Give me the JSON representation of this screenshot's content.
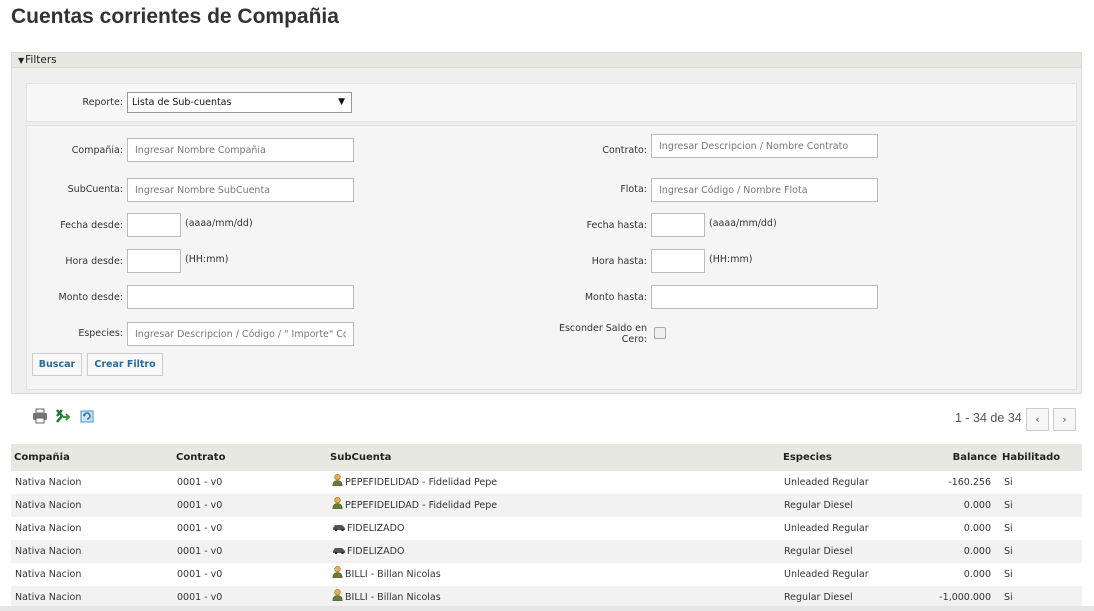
{
  "page": {
    "title": "Cuentas corrientes de Compañia"
  },
  "filters": {
    "header": "Filters",
    "reporte_label": "Reporte:",
    "reporte_value": "Lista de Sub-cuentas",
    "compania_label": "Compañia:",
    "compania_placeholder": "Ingresar Nombre Compañia",
    "contrato_label": "Contrato:",
    "contrato_placeholder": "Ingresar Descripcion / Nombre Contrato",
    "subcuenta_label": "SubCuenta:",
    "subcuenta_placeholder": "Ingresar Nombre SubCuenta",
    "flota_label": "Flota:",
    "flota_placeholder": "Ingresar Código / Nombre Flota",
    "fecha_desde_label": "Fecha desde:",
    "fecha_hasta_label": "Fecha hasta:",
    "fecha_hint": "(aaaa/mm/dd)",
    "hora_desde_label": "Hora desde:",
    "hora_hasta_label": "Hora hasta:",
    "hora_hint": "(HH:mm)",
    "monto_desde_label": "Monto desde:",
    "monto_hasta_label": "Monto hasta:",
    "especies_label": "Especies:",
    "especies_placeholder": "Ingresar Descripcion / Código / \" Importe\" Coml",
    "esconder_label_1": "Esconder Saldo en",
    "esconder_label_2": "Cero:",
    "buscar_label": "Buscar",
    "crear_filtro_label": "Crear Filtro"
  },
  "toolbar": {
    "print_icon": "printer-icon",
    "excel_icon": "excel-export-icon",
    "refresh_icon": "refresh-icon"
  },
  "pager": {
    "text": "1 - 34 de 34",
    "prev": "‹",
    "next": "›"
  },
  "grid": {
    "columns": {
      "compania": "Compañia",
      "contrato": "Contrato",
      "subcuenta": "SubCuenta",
      "especies": "Especies",
      "balance": "Balance",
      "habilitado": "Habilitado"
    },
    "rows": [
      {
        "compania": "Nativa Nacion",
        "contrato": "0001 - v0",
        "icon": "person",
        "subcuenta": "PEPEFIDELIDAD - Fidelidad Pepe",
        "especies": "Unleaded Regular",
        "balance": "-160.256",
        "habilitado": "Si"
      },
      {
        "compania": "Nativa Nacion",
        "contrato": "0001 - v0",
        "icon": "person",
        "subcuenta": "PEPEFIDELIDAD - Fidelidad Pepe",
        "especies": "Regular Diesel",
        "balance": "0.000",
        "habilitado": "Si"
      },
      {
        "compania": "Nativa Nacion",
        "contrato": "0001 - v0",
        "icon": "car",
        "subcuenta": "FIDELIZADO",
        "especies": "Unleaded Regular",
        "balance": "0.000",
        "habilitado": "Si"
      },
      {
        "compania": "Nativa Nacion",
        "contrato": "0001 - v0",
        "icon": "car",
        "subcuenta": "FIDELIZADO",
        "especies": "Regular Diesel",
        "balance": "0.000",
        "habilitado": "Si"
      },
      {
        "compania": "Nativa Nacion",
        "contrato": "0001 - v0",
        "icon": "person",
        "subcuenta": "BILLI - Billan Nicolas",
        "especies": "Unleaded Regular",
        "balance": "0.000",
        "habilitado": "Si"
      },
      {
        "compania": "Nativa Nacion",
        "contrato": "0001 - v0",
        "icon": "person",
        "subcuenta": "BILLI - Billan Nicolas",
        "especies": "Regular Diesel",
        "balance": "-1,000.000",
        "habilitado": "Si"
      }
    ]
  }
}
